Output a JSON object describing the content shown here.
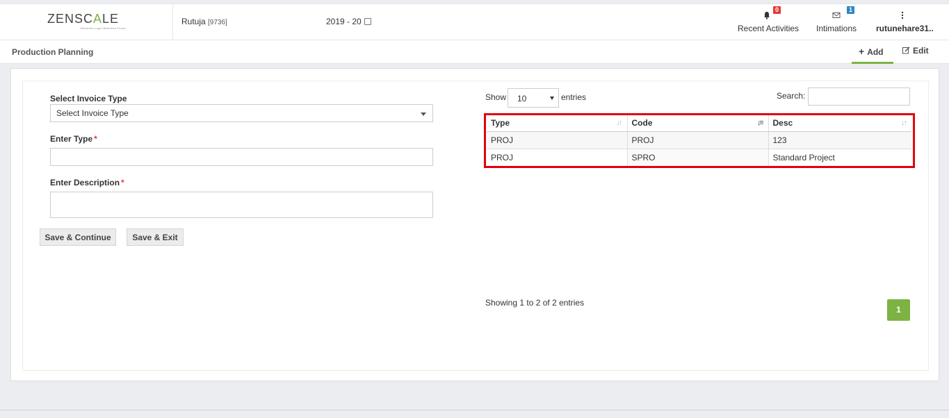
{
  "header": {
    "logo": {
      "text_left": "ZENSC",
      "text_accent": "A",
      "text_right": "LE",
      "tagline": "Business Logic Business Focus"
    },
    "user": {
      "name": "Rutuja",
      "code": "[9736]"
    },
    "fiscal_year": "2019 - 20",
    "recent_activities": {
      "label": "Recent Activities",
      "badge": "0",
      "badge_color": "#e53935"
    },
    "intimations": {
      "label": "Intimations",
      "badge": "1",
      "badge_color": "#2e86c1"
    },
    "account": {
      "label": "rutunehare31.."
    }
  },
  "subheader": {
    "title": "Production Planning",
    "tabs": {
      "add": "Add",
      "edit": "Edit"
    },
    "active_tab_color": "#7cb342"
  },
  "form": {
    "invoice_type_label": "Select Invoice Type",
    "invoice_type_value": "Select Invoice Type",
    "type_label": "Enter Type",
    "description_label": "Enter Description",
    "required_mark": "*",
    "save_continue": "Save & Continue",
    "save_exit": "Save & Exit"
  },
  "table_controls": {
    "show_label": "Show",
    "page_length": "10",
    "entries_label": "entries",
    "search_label": "Search:"
  },
  "table": {
    "headers": [
      "Type",
      "Code",
      "Desc"
    ],
    "sorted_column": "Code",
    "rows": [
      [
        "PROJ",
        "PROJ",
        "123"
      ],
      [
        "PROJ",
        "SPRO",
        "Standard Project"
      ]
    ],
    "highlight_color": "#e2000f"
  },
  "pagination": {
    "info": "Showing 1 to 2 of 2 entries",
    "current_page": "1",
    "page_color": "#7cb342"
  }
}
